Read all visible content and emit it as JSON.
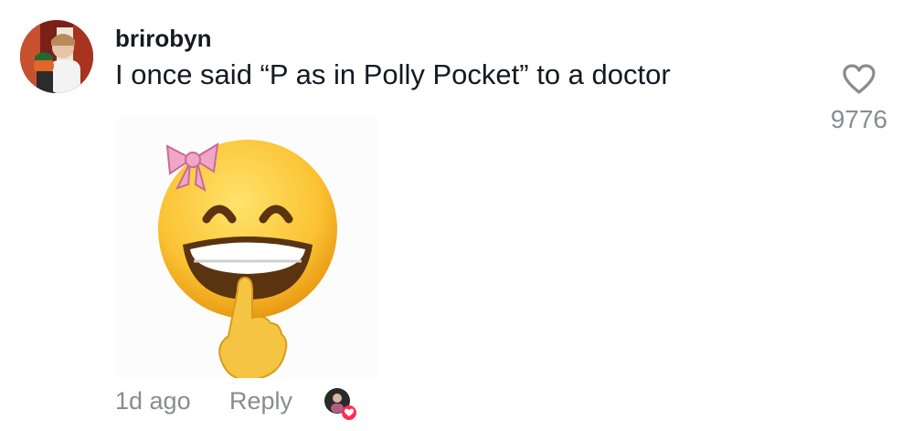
{
  "comment": {
    "username": "brirobyn",
    "text": "I once said “P as in Polly Pocket” to a doctor",
    "like_count": "9776",
    "timestamp": "1d ago",
    "reply_label": "Reply"
  },
  "colors": {
    "text_primary": "#161823",
    "text_secondary": "#8a8b91",
    "creator_like_badge": "#fe2c55"
  },
  "icons": {
    "like": "heart-outline-icon",
    "creator_liked_badge": "red-heart-icon"
  }
}
